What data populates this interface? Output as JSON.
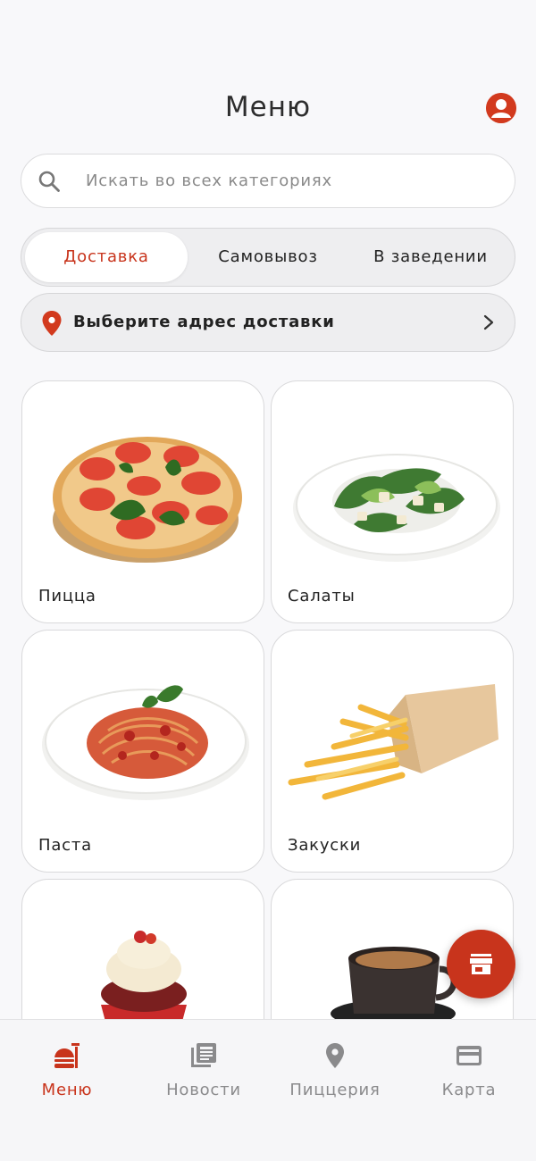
{
  "header": {
    "title": "Меню"
  },
  "search": {
    "placeholder": "Искать во всех категориях"
  },
  "delivery_modes": [
    {
      "label": "Доставка",
      "active": true
    },
    {
      "label": "Самовывоз",
      "active": false
    },
    {
      "label": "В заведении",
      "active": false
    }
  ],
  "address": {
    "label": "Выберите адрес доставки"
  },
  "categories": [
    {
      "label": "Пицца"
    },
    {
      "label": "Салаты"
    },
    {
      "label": "Паста"
    },
    {
      "label": "Закуски"
    },
    {
      "label": ""
    },
    {
      "label": ""
    }
  ],
  "bottom_nav": [
    {
      "label": "Меню",
      "icon": "menu-food-icon",
      "active": true
    },
    {
      "label": "Новости",
      "icon": "news-icon",
      "active": false
    },
    {
      "label": "Пиццерия",
      "icon": "location-pin-icon",
      "active": false
    },
    {
      "label": "Карта",
      "icon": "card-icon",
      "active": false
    }
  ],
  "colors": {
    "accent": "#c8341c",
    "background": "#f8f8fa",
    "inactive": "#8a8a8c"
  }
}
